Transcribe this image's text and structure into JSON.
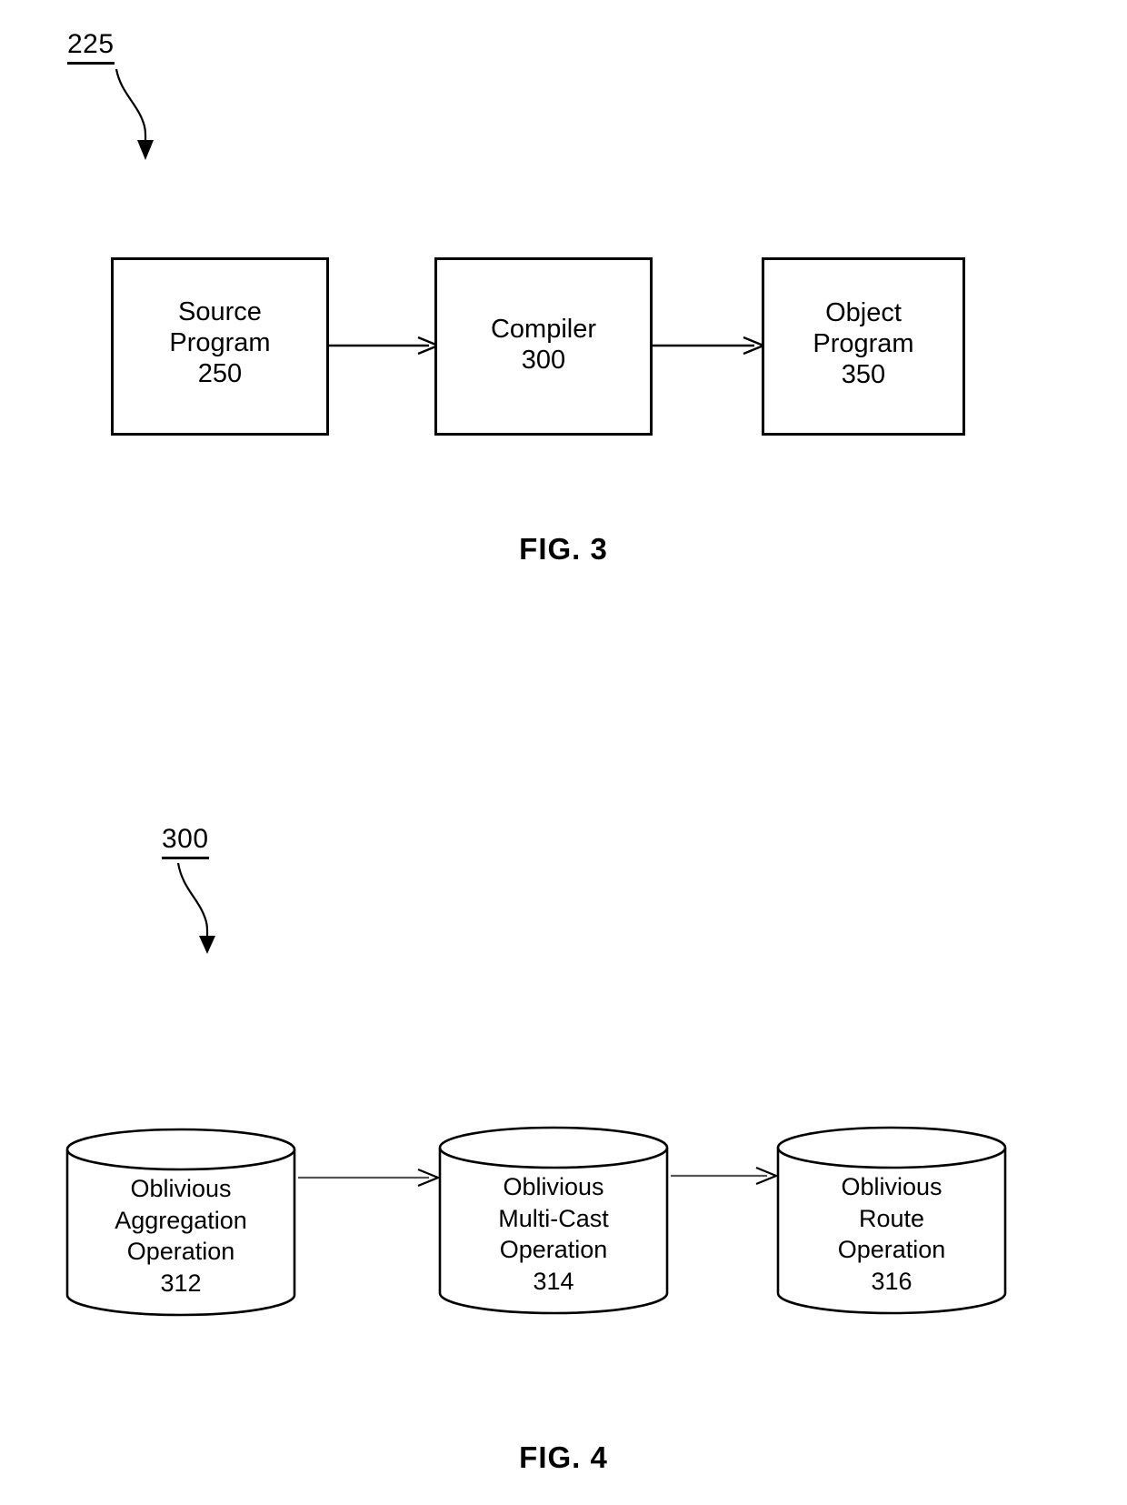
{
  "figures": [
    {
      "id": "fig3",
      "reference_numeral": "225",
      "caption": "FIG. 3",
      "type": "block-flow",
      "nodes": [
        {
          "id": "source",
          "shape": "rectangle",
          "lines": [
            "Source",
            "Program",
            "250"
          ],
          "numeral": "250"
        },
        {
          "id": "compiler",
          "shape": "rectangle",
          "lines": [
            "Compiler",
            "300"
          ],
          "numeral": "300"
        },
        {
          "id": "object",
          "shape": "rectangle",
          "lines": [
            "Object",
            "Program",
            "350"
          ],
          "numeral": "350"
        }
      ],
      "edges": [
        {
          "from": "source",
          "to": "compiler",
          "style": "solid-arrow"
        },
        {
          "from": "compiler",
          "to": "object",
          "style": "solid-arrow"
        }
      ]
    },
    {
      "id": "fig4",
      "reference_numeral": "300",
      "caption": "FIG. 4",
      "type": "block-flow",
      "nodes": [
        {
          "id": "aggregation",
          "shape": "cylinder",
          "lines": [
            "Oblivious",
            "Aggregation",
            "Operation",
            "312"
          ],
          "numeral": "312"
        },
        {
          "id": "multicast",
          "shape": "cylinder",
          "lines": [
            "Oblivious",
            "Multi-Cast",
            "Operation",
            "314"
          ],
          "numeral": "314"
        },
        {
          "id": "route",
          "shape": "cylinder",
          "lines": [
            "Oblivious",
            "Route",
            "Operation",
            "316"
          ],
          "numeral": "316"
        }
      ],
      "edges": [
        {
          "from": "aggregation",
          "to": "multicast",
          "style": "solid-arrow"
        },
        {
          "from": "multicast",
          "to": "route",
          "style": "solid-arrow"
        }
      ]
    }
  ],
  "colors": {
    "line": "#000000",
    "background": "#ffffff",
    "faint_line": "#555555"
  }
}
